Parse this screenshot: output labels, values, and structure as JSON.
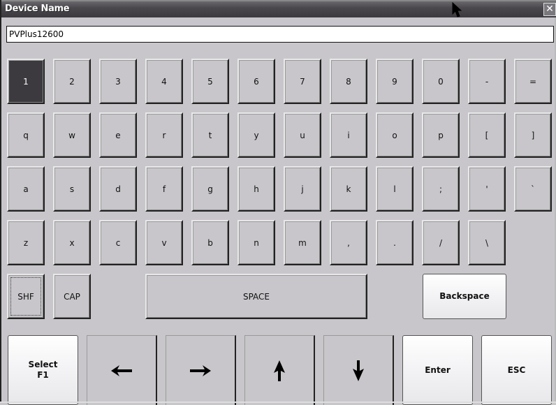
{
  "window": {
    "title": "Device Name",
    "close_icon": "close-icon"
  },
  "input": {
    "value": "PVPlus12600"
  },
  "keyboard": {
    "rows": [
      [
        "1",
        "2",
        "3",
        "4",
        "5",
        "6",
        "7",
        "8",
        "9",
        "0",
        "-",
        "="
      ],
      [
        "q",
        "w",
        "e",
        "r",
        "t",
        "y",
        "u",
        "i",
        "o",
        "p",
        "[",
        "]"
      ],
      [
        "a",
        "s",
        "d",
        "f",
        "g",
        "h",
        "j",
        "k",
        "l",
        ";",
        "'",
        "`"
      ],
      [
        "z",
        "x",
        "c",
        "v",
        "b",
        "n",
        "m",
        ",",
        ".",
        "/",
        "\\"
      ]
    ],
    "active_key": "1",
    "shift_label": "SHF",
    "caps_label": "CAP",
    "space_label": "SPACE",
    "backspace_label": "Backspace"
  },
  "bottom_bar": {
    "select_label_line1": "Select",
    "select_label_line2": "F1",
    "left_icon": "arrow-left-icon",
    "right_icon": "arrow-right-icon",
    "up_icon": "arrow-up-icon",
    "down_icon": "arrow-down-icon",
    "enter_label": "Enter",
    "esc_label": "ESC"
  }
}
